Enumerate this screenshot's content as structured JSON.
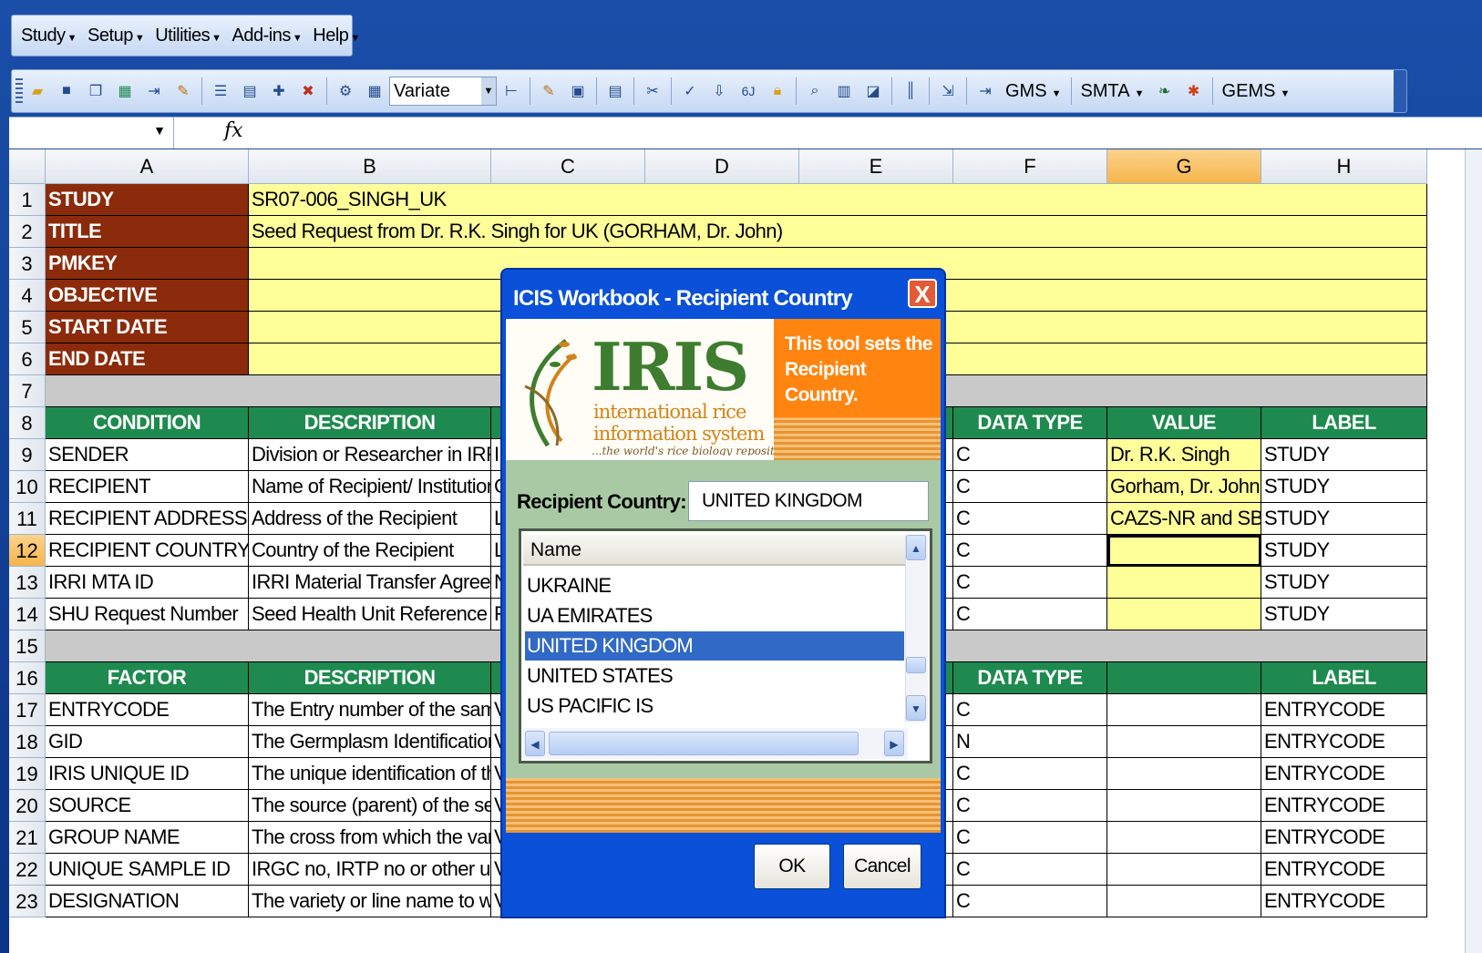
{
  "menubar": {
    "items": [
      "Study",
      "Setup",
      "Utilities",
      "Add-ins",
      "Help"
    ]
  },
  "toolbar": {
    "combo_value": "Variate",
    "gms_label": "GMS",
    "smta_label": "SMTA",
    "gems_label": "GEMS"
  },
  "formula": {
    "fx": "fx"
  },
  "columns": [
    "A",
    "B",
    "C",
    "D",
    "E",
    "F",
    "G",
    "H"
  ],
  "rows": {
    "1": {
      "a": "STUDY",
      "b": "SR07-006_SINGH_UK"
    },
    "2": {
      "a": "TITLE",
      "b": "Seed Request from Dr. R.K. Singh for UK (GORHAM, Dr. John)"
    },
    "3": {
      "a": "PMKEY"
    },
    "4": {
      "a": "OBJECTIVE"
    },
    "5": {
      "a": "START DATE"
    },
    "6": {
      "a": "END DATE"
    },
    "8": {
      "a": "CONDITION",
      "b": "DESCRIPTION",
      "f": "DATA TYPE",
      "g": "VALUE",
      "h": "LABEL"
    },
    "9": {
      "a": "SENDER",
      "b": "Division or Researcher in IRRI",
      "c": "I",
      "f": "C",
      "g": "Dr. R.K. Singh",
      "h": "STUDY"
    },
    "10": {
      "a": "RECIPIENT",
      "b": "Name of Recipient/ Institution",
      "c": "C",
      "f": "C",
      "g": "Gorham, Dr. John",
      "h": "STUDY"
    },
    "11": {
      "a": "RECIPIENT ADDRESS",
      "b": "Address of the Recipient",
      "c": "L",
      "f": "C",
      "g": "CAZS-NR and SBS,",
      "h": "STUDY"
    },
    "12": {
      "a": "RECIPIENT COUNTRY",
      "b": "Country of the Recipient",
      "c": "L",
      "f": "C",
      "g": "",
      "h": "STUDY"
    },
    "13": {
      "a": "IRRI MTA ID",
      "b": "IRRI Material Transfer Agreeme",
      "c": "N",
      "f": "C",
      "g": "",
      "h": "STUDY"
    },
    "14": {
      "a": "SHU Request Number",
      "b": "Seed Health Unit Reference Nu",
      "c": "F",
      "f": "C",
      "g": "",
      "h": "STUDY"
    },
    "16": {
      "a": "FACTOR",
      "b": "DESCRIPTION",
      "f": "DATA TYPE",
      "h": "LABEL"
    },
    "17": {
      "a": "ENTRYCODE",
      "b": "The Entry number of the sampl",
      "c": "V",
      "f": "C",
      "h": "ENTRYCODE"
    },
    "18": {
      "a": "GID",
      "b": "The Germplasm Identification d",
      "c": "V",
      "f": "N",
      "h": "ENTRYCODE"
    },
    "19": {
      "a": "IRIS UNIQUE ID",
      "b": "The unique identification of the",
      "c": "V",
      "f": "C",
      "h": "ENTRYCODE"
    },
    "20": {
      "a": "SOURCE",
      "b": "The source (parent) of the seed",
      "c": "V",
      "f": "C",
      "h": "ENTRYCODE"
    },
    "21": {
      "a": "GROUP NAME",
      "b": "The cross from which the variet",
      "c": "V",
      "f": "C",
      "h": "ENTRYCODE"
    },
    "22": {
      "a": "UNIQUE SAMPLE ID",
      "b": "IRGC no, IRTP no or other uniq",
      "c": "V",
      "f": "C",
      "h": "ENTRYCODE"
    },
    "23": {
      "a": "DESIGNATION",
      "b": "The variety or line name to whic",
      "c": "V",
      "f": "C",
      "h": "ENTRYCODE"
    }
  },
  "dialog": {
    "title": "ICIS Workbook - Recipient Country",
    "close": "X",
    "logo_text": "IRIS",
    "logo_line1": "international rice",
    "logo_line2": "information system",
    "logo_tagline": "...the world's rice biology repository",
    "info": "This tool sets the Recipient Country.",
    "field_label": "Recipient Country:",
    "field_value": "UNITED KINGDOM",
    "list_header": "Name",
    "list_items": [
      "UKRAINE",
      "UA EMIRATES",
      "UNITED KINGDOM",
      "UNITED STATES",
      "US PACIFIC IS"
    ],
    "selected_index": 2,
    "ok": "OK",
    "cancel": "Cancel"
  },
  "colors": {
    "brown": "#8b2b0b",
    "green": "#1e8a4f",
    "yellow": "#ffff99",
    "orange": "#ff8410",
    "dialog_blue": "#0a50d8",
    "selection": "#3169c6"
  }
}
